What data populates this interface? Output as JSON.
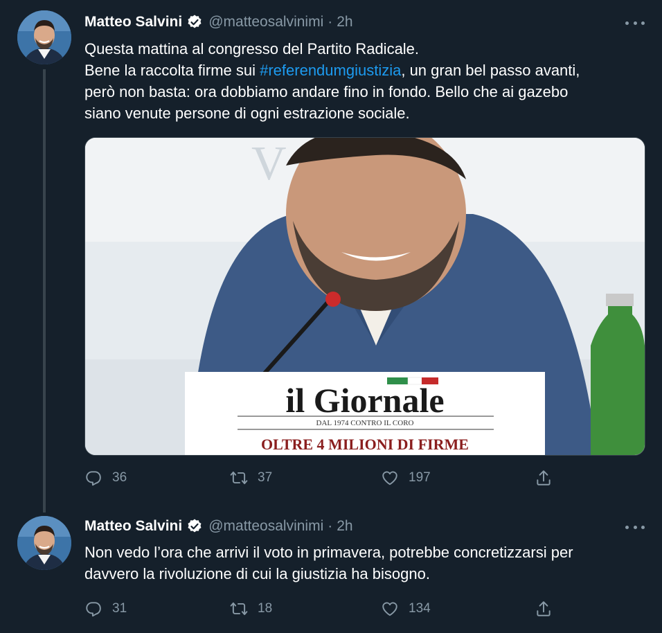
{
  "tweets": [
    {
      "author_name": "Matteo Salvini",
      "handle": "@matteosalvinimi",
      "separator": "·",
      "time": "2h",
      "lines": [
        "Questa mattina al congresso del Partito Radicale.",
        "Bene la raccolta firme sui ",
        "#referendumgiustizia",
        ", un gran bel passo avanti,",
        "però non basta: ora dobbiamo andare fino in fondo. Bello che ai gazebo",
        "siano venute persone di ogni estrazione sociale."
      ],
      "media": {
        "newspaper_title": "il Giornale",
        "newspaper_tagline": "DAL 1974 CONTRO IL CORO",
        "headline": "OLTRE 4 MILIONI DI FIRME",
        "background_text": "V            mina, 1"
      },
      "replies": "36",
      "retweets": "37",
      "likes": "197"
    },
    {
      "author_name": "Matteo Salvini",
      "handle": "@matteosalvinimi",
      "separator": "·",
      "time": "2h",
      "lines": [
        "Non vedo l’ora che arrivi il voto in primavera, potrebbe concretizzarsi per",
        "davvero la rivoluzione di cui la giustizia ha bisogno."
      ],
      "replies": "31",
      "retweets": "18",
      "likes": "134"
    }
  ],
  "icons": {
    "reply": "reply-icon",
    "retweet": "retweet-icon",
    "like": "heart-icon",
    "share": "share-icon",
    "verified": "verified-badge-icon",
    "more": "more-icon"
  },
  "colors": {
    "background": "#15202b",
    "secondary_text": "#8899a6",
    "link": "#1d9bf0",
    "thread_line": "#38444d"
  }
}
